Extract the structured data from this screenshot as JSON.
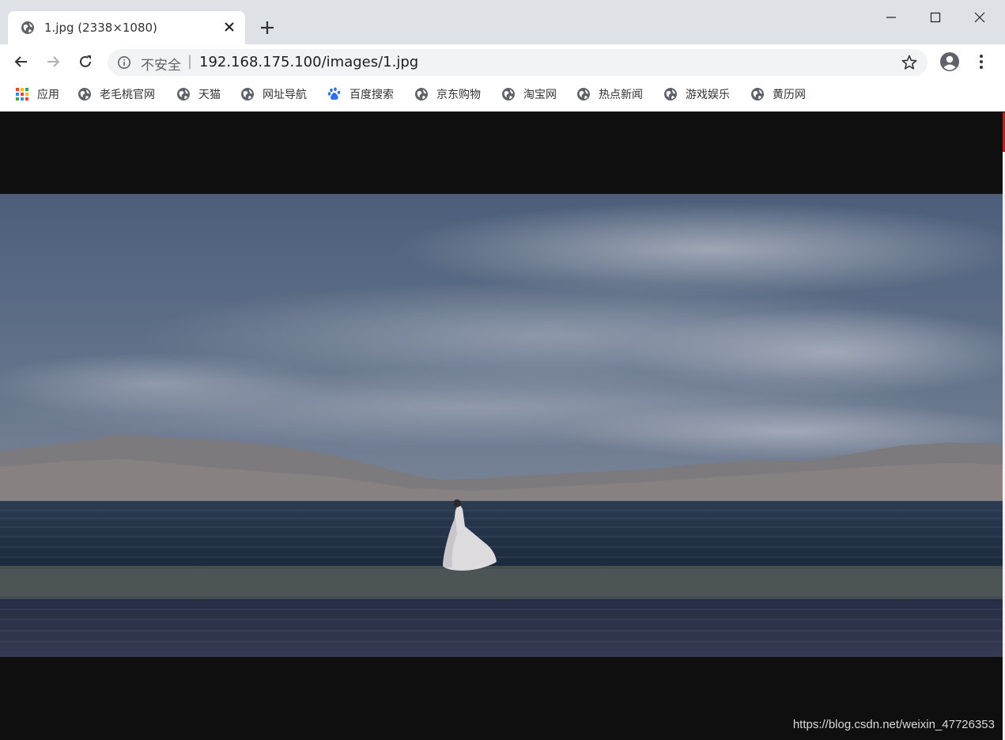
{
  "tab": {
    "title": "1.jpg (2338×1080)"
  },
  "window_controls": {
    "minimize": "–",
    "maximize": "□",
    "close": "✕"
  },
  "omnibox": {
    "security": "不安全",
    "separator": "|",
    "url": "192.168.175.100/images/1.jpg"
  },
  "bookmarks": [
    {
      "label": "应用",
      "icon": "apps-grid-icon"
    },
    {
      "label": "老毛桃官网",
      "icon": "globe-icon"
    },
    {
      "label": "天猫",
      "icon": "globe-icon"
    },
    {
      "label": "网址导航",
      "icon": "globe-icon"
    },
    {
      "label": "百度搜索",
      "icon": "baidu-paw-icon"
    },
    {
      "label": "京东购物",
      "icon": "globe-icon"
    },
    {
      "label": "淘宝网",
      "icon": "globe-icon"
    },
    {
      "label": "热点新闻",
      "icon": "globe-icon"
    },
    {
      "label": "游戏娱乐",
      "icon": "globe-icon"
    },
    {
      "label": "黄历网",
      "icon": "globe-icon"
    }
  ],
  "watermark": "https://blog.csdn.net/weixin_47726353",
  "colors": {
    "tabstrip": "#dee1e6",
    "omnibox": "#f1f3f4",
    "viewport_bg": "#0f0f0f"
  }
}
